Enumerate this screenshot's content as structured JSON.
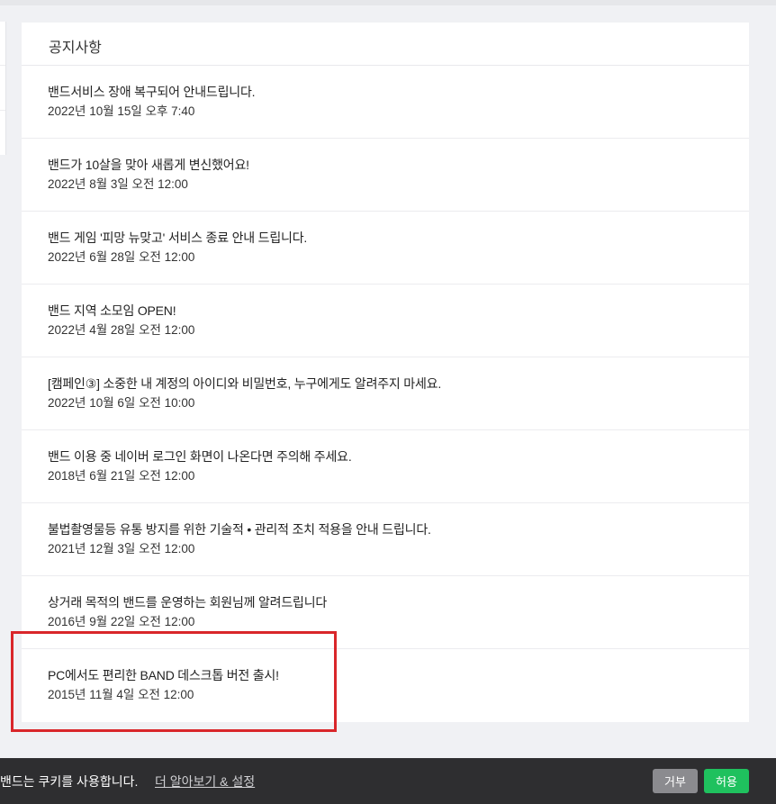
{
  "notice": {
    "title": "공지사항",
    "items": [
      {
        "title": "밴드서비스 장애 복구되어 안내드립니다.",
        "date": "2022년 10월 15일 오후 7:40"
      },
      {
        "title": "밴드가 10살을 맞아 새롭게 변신했어요!",
        "date": "2022년 8월 3일 오전 12:00"
      },
      {
        "title": "밴드 게임 '피망 뉴맞고' 서비스 종료 안내 드립니다.",
        "date": "2022년 6월 28일 오전 12:00"
      },
      {
        "title": "밴드 지역 소모임 OPEN!",
        "date": "2022년 4월 28일 오전 12:00"
      },
      {
        "title": "[캠페인③] 소중한 내 계정의 아이디와 비밀번호, 누구에게도 알려주지 마세요.",
        "date": "2022년 10월 6일 오전 10:00"
      },
      {
        "title": "밴드 이용 중 네이버 로그인 화면이 나온다면 주의해 주세요.",
        "date": "2018년 6월 21일 오전 12:00"
      },
      {
        "title": "불법촬영물등 유통 방지를 위한 기술적 • 관리적 조치 적용을 안내 드립니다.",
        "date": "2021년 12월 3일 오전 12:00"
      },
      {
        "title": "상거래 목적의 밴드를 운영하는 회원님께 알려드립니다",
        "date": "2016년 9월 22일 오전 12:00"
      },
      {
        "title": "PC에서도 편리한 BAND 데스크톱 버전 출시!",
        "date": "2015년 11월 4일 오전 12:00"
      }
    ]
  },
  "cookie_bar": {
    "message": "밴드는 쿠키를 사용합니다.",
    "link_label": "더 알아보기 & 설정",
    "reject_label": "거부",
    "accept_label": "허용"
  },
  "colors": {
    "highlight": "#d9262a",
    "accept": "#1fc15e",
    "reject": "#8b8b8f",
    "cookie_bar_bg": "#2e2e30"
  }
}
